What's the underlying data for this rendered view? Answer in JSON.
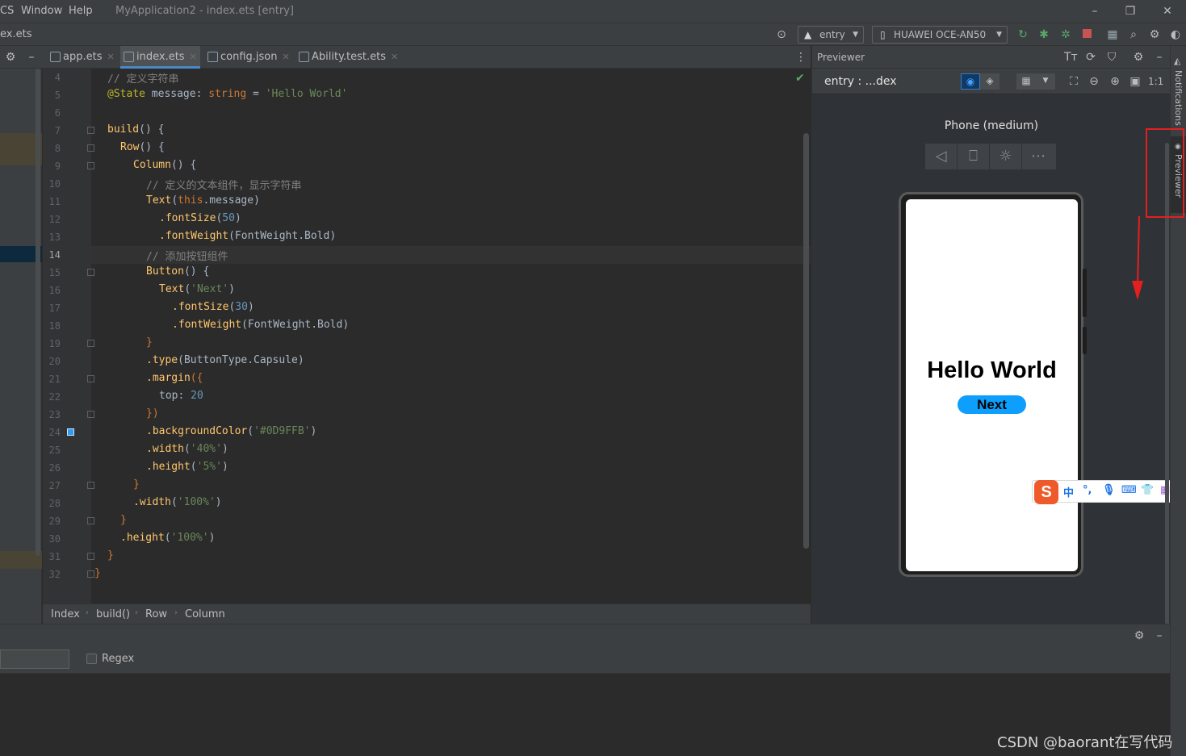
{
  "menu": {
    "items": [
      "CS",
      "Window",
      "Help"
    ]
  },
  "window_title": "MyApplication2 - index.ets [entry]",
  "nav": {
    "file_crumb": "ex.ets",
    "module_combo": "entry",
    "device_combo": "HUAWEI OCE-AN50"
  },
  "tabs": [
    {
      "label": "app.ets",
      "active": false
    },
    {
      "label": "index.ets",
      "active": true
    },
    {
      "label": "config.json",
      "active": false
    },
    {
      "label": "Ability.test.ets",
      "active": false
    }
  ],
  "editor": {
    "current_line": "14",
    "line_numbers": [
      "4",
      "5",
      "6",
      "7",
      "8",
      "9",
      "10",
      "11",
      "12",
      "13",
      "14",
      "15",
      "16",
      "17",
      "18",
      "19",
      "20",
      "21",
      "22",
      "23",
      "24",
      "25",
      "26",
      "27",
      "28",
      "29",
      "30",
      "31",
      "32"
    ],
    "lines": {
      "l4": "// 定义字符串",
      "l5_dec": "@State",
      "l5_name": " message",
      "l5_colon": ": ",
      "l5_type": "string",
      "l5_eq": " = ",
      "l5_val": "'Hello World'",
      "l7_fn": "build",
      "l7_rest": "() {",
      "l8_fn": "Row",
      "l8_rest": "() {",
      "l9_fn": "Column",
      "l9_rest": "() {",
      "l10": "// 定义的文本组件，显示字符串",
      "l11_fn": "Text",
      "l11_kw": "this",
      "l11_rest": ".message)",
      "l12_m": ".fontSize",
      "l12_n": "50",
      "l13_m": ".fontWeight",
      "l13_v": "FontWeight.Bold",
      "l14": "// 添加按钮组件",
      "l15_fn": "Button",
      "l15_rest": "() {",
      "l16_fn": "Text",
      "l16_s": "'Next'",
      "l17_m": ".fontSize",
      "l17_n": "30",
      "l18_m": ".fontWeight",
      "l18_v": "FontWeight.Bold",
      "l19": "}",
      "l20_m": ".type",
      "l20_v": "ButtonType.Capsule",
      "l21_m": ".margin",
      "l21_rest": "({",
      "l22_k": "top",
      "l22_n": "20",
      "l23": "})",
      "l24_m": ".backgroundColor",
      "l24_s": "'#0D9FFB'",
      "l25_m": ".width",
      "l25_s": "'40%'",
      "l26_m": ".height",
      "l26_s": "'5%'",
      "l27": "}",
      "l28_m": ".width",
      "l28_s": "'100%'",
      "l29": "}",
      "l30_m": ".height",
      "l30_s": "'100%'",
      "l31": "}",
      "l32": "}"
    }
  },
  "breadcrumb": [
    "Index",
    "build()",
    "Row",
    "Column"
  ],
  "previewer": {
    "title": "Previewer",
    "target": "entry : ...dex",
    "device_label": "Phone (medium)",
    "app_text": "Hello World",
    "button_text": "Next",
    "button_color": "#0D9FFB",
    "zoom_label": "1:1"
  },
  "ime": {
    "label": "中"
  },
  "right_strip": {
    "notifications": "Notifications",
    "previewer": "Previewer"
  },
  "bottom": {
    "regex_label": "Regex"
  },
  "watermark": "CSDN @baorant在写代码",
  "colors": {
    "accent": "#4a88c7",
    "highlight": "#e51f1f"
  }
}
